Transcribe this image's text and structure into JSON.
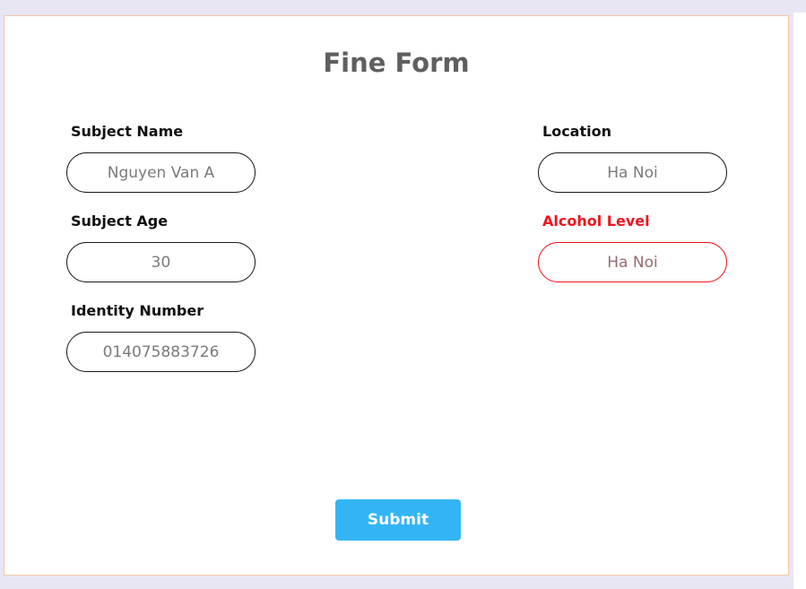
{
  "form": {
    "title": "Fine Form",
    "fields": {
      "subject_name": {
        "label": "Subject Name",
        "value": "Nguyen Van A"
      },
      "subject_age": {
        "label": "Subject Age",
        "value": "30"
      },
      "identity_number": {
        "label": "Identity Number",
        "value": "014075883726"
      },
      "location": {
        "label": "Location",
        "value": "Ha Noi"
      },
      "alcohol_level": {
        "label": "Alcohol Level",
        "value": "Ha Noi",
        "state": "error"
      }
    },
    "submit_label": "Submit"
  },
  "colors": {
    "accent": "#33b5f5",
    "error": "#f0141e",
    "title": "#5f5f5f",
    "frame_border": "#f3c7a4"
  }
}
